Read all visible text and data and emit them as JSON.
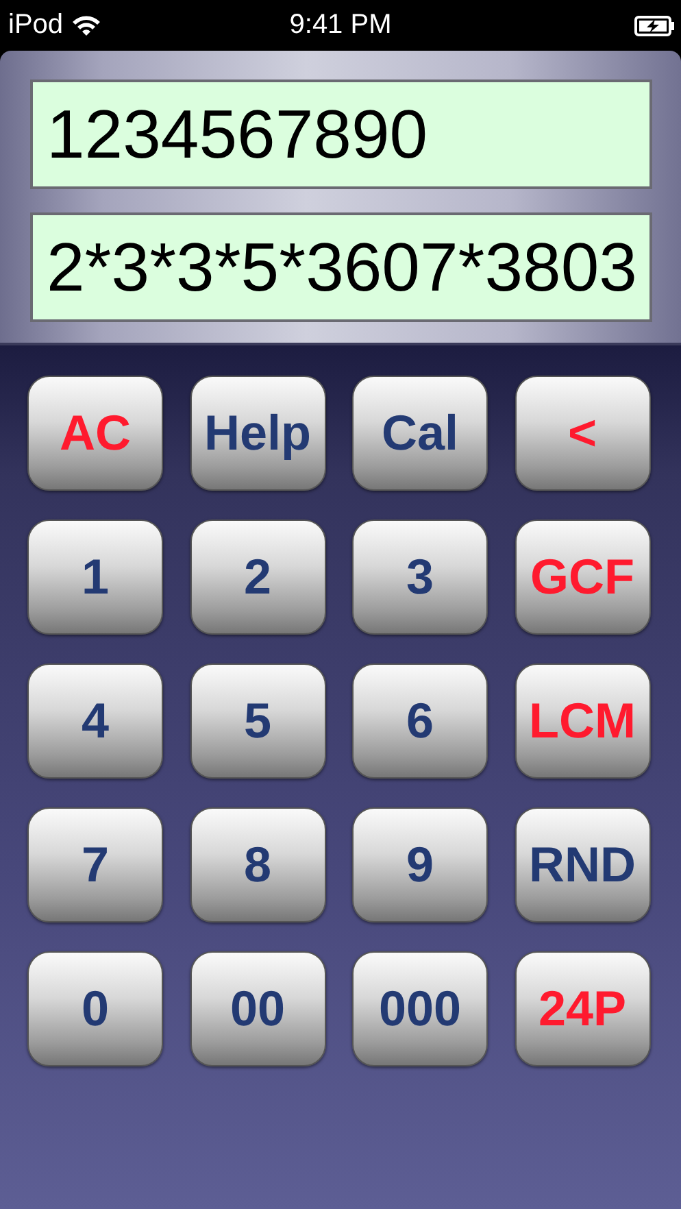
{
  "status_bar": {
    "carrier": "iPod",
    "time": "9:41 PM"
  },
  "display": {
    "input": "1234567890",
    "result": "2*3*3*5*3607*3803"
  },
  "keys": [
    {
      "label": "AC",
      "color": "#ff1a2e"
    },
    {
      "label": "Help",
      "color": "#233a73"
    },
    {
      "label": "Cal",
      "color": "#233a73"
    },
    {
      "label": "<",
      "color": "#ff1a2e"
    },
    {
      "label": "1",
      "color": "#233a73"
    },
    {
      "label": "2",
      "color": "#233a73"
    },
    {
      "label": "3",
      "color": "#233a73"
    },
    {
      "label": "GCF",
      "color": "#ff1a2e"
    },
    {
      "label": "4",
      "color": "#233a73"
    },
    {
      "label": "5",
      "color": "#233a73"
    },
    {
      "label": "6",
      "color": "#233a73"
    },
    {
      "label": "LCM",
      "color": "#ff1a2e"
    },
    {
      "label": "7",
      "color": "#233a73"
    },
    {
      "label": "8",
      "color": "#233a73"
    },
    {
      "label": "9",
      "color": "#233a73"
    },
    {
      "label": "RND",
      "color": "#233a73"
    },
    {
      "label": "0",
      "color": "#233a73"
    },
    {
      "label": "00",
      "color": "#233a73"
    },
    {
      "label": "000",
      "color": "#233a73"
    },
    {
      "label": "24P",
      "color": "#ff1a2e"
    }
  ]
}
